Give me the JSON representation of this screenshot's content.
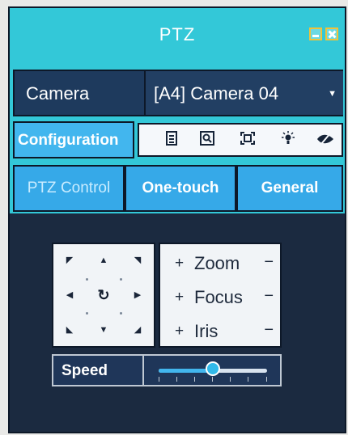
{
  "window": {
    "title": "PTZ"
  },
  "camera": {
    "label": "Camera",
    "value": "[A4] Camera 04"
  },
  "configuration": {
    "label": "Configuration"
  },
  "toolbar": {
    "icons": [
      "preset-list-icon",
      "search-icon",
      "fullscreen-icon",
      "light-icon",
      "wiper-icon"
    ]
  },
  "tabs": [
    {
      "label": "PTZ Control"
    },
    {
      "label": "One-touch"
    },
    {
      "label": "General"
    }
  ],
  "adjust": {
    "rows": [
      {
        "plus": "+",
        "label": "Zoom",
        "minus": "−"
      },
      {
        "plus": "+",
        "label": "Focus",
        "minus": "−"
      },
      {
        "plus": "+",
        "label": "Iris",
        "minus": "−"
      }
    ]
  },
  "speed": {
    "label": "Speed",
    "level": 0.5
  }
}
